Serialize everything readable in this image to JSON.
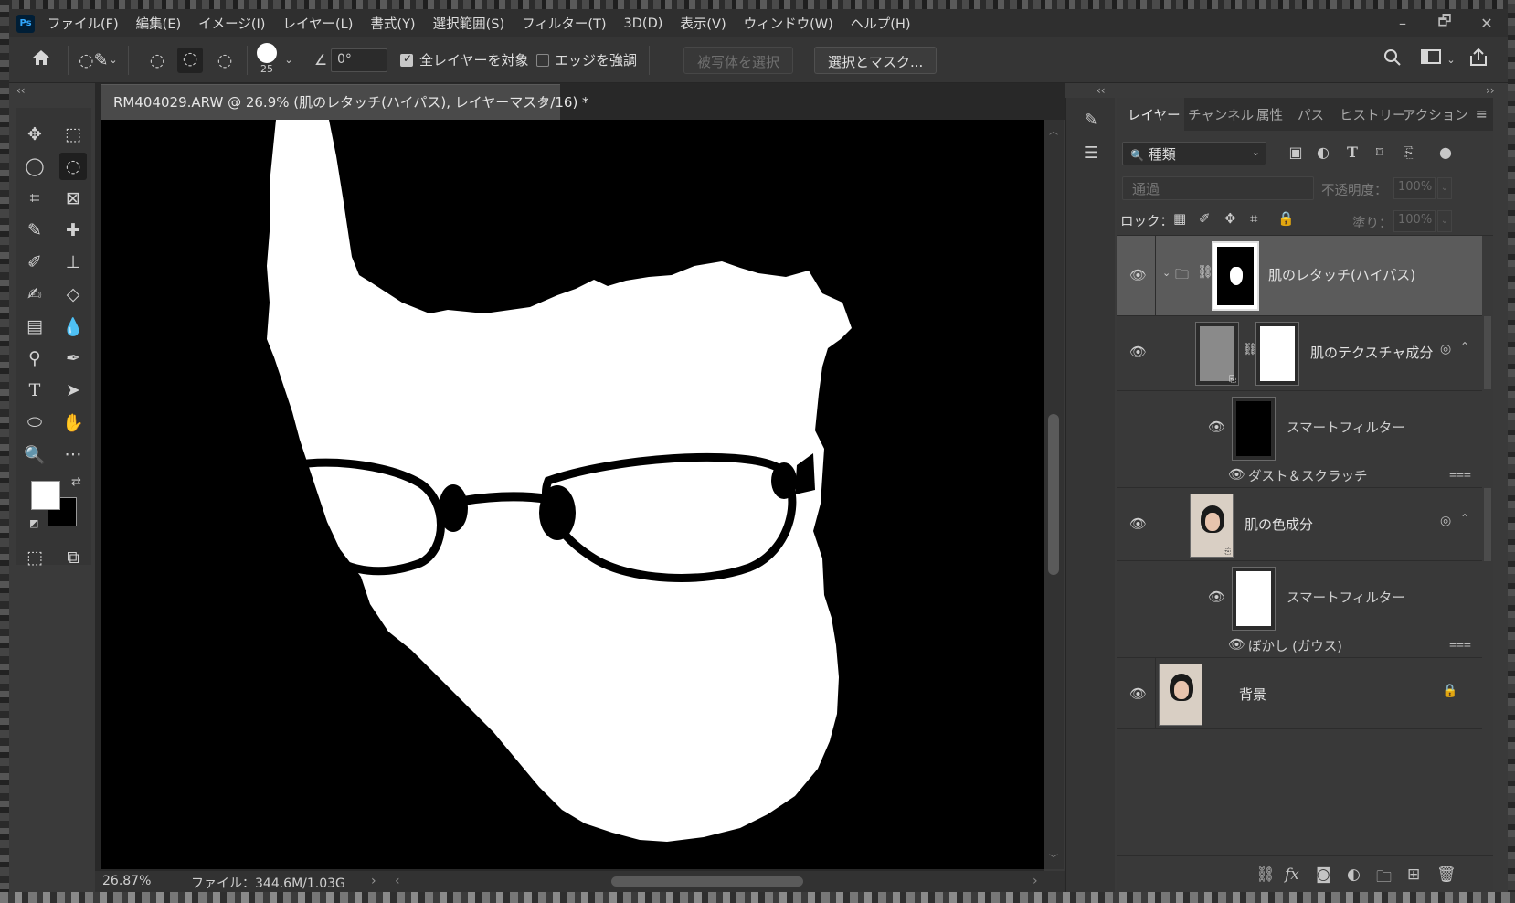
{
  "app": {
    "logo": "Ps"
  },
  "menu": [
    "ファイル(F)",
    "編集(E)",
    "イメージ(I)",
    "レイヤー(L)",
    "書式(Y)",
    "選択範囲(S)",
    "フィルター(T)",
    "3D(D)",
    "表示(V)",
    "ウィンドウ(W)",
    "ヘルプ(H)"
  ],
  "window_controls": {
    "minimize": "–",
    "restore": "🗗",
    "close": "✕"
  },
  "options": {
    "brush_size": "25",
    "angle": "0°",
    "sample_all_layers": {
      "label": "全レイヤーを対象",
      "checked": true
    },
    "enhance_edge": {
      "label": "エッジを強調",
      "checked": false
    },
    "select_subject": "被写体を選択",
    "select_and_mask": "選択とマスク..."
  },
  "document": {
    "tab_title": "RM404029.ARW @ 26.9% (肌のレタッチ(ハイパス), レイヤーマスク/16) *",
    "zoom": "26.87%",
    "file_info": "ファイル：344.6M/1.03G"
  },
  "panel_tabs": [
    "レイヤー",
    "チャンネル",
    "属性",
    "パス",
    "ヒストリー",
    "アクション"
  ],
  "layers_panel": {
    "kind_filter": "種類",
    "blend_mode": "通過",
    "opacity_label": "不透明度：",
    "opacity": "100%",
    "lock_label": "ロック：",
    "fill_label": "塗り：",
    "fill": "100%"
  },
  "layers": [
    {
      "name": "肌のレタッチ(ハイパス)",
      "type": "group",
      "selected": true
    },
    {
      "name": "肌のテクスチャ成分",
      "type": "smart-object"
    },
    {
      "name": "スマートフィルター",
      "type": "smart-filter"
    },
    {
      "name": "ダスト＆スクラッチ",
      "type": "filter-effect"
    },
    {
      "name": "肌の色成分",
      "type": "smart-object"
    },
    {
      "name": "スマートフィルター",
      "type": "smart-filter"
    },
    {
      "name": "ぼかし (ガウス)",
      "type": "filter-effect"
    },
    {
      "name": "背景",
      "type": "background",
      "locked": true
    }
  ],
  "colors": {
    "foreground": "#ffffff",
    "background": "#000000",
    "accent": "#31a8ff"
  }
}
